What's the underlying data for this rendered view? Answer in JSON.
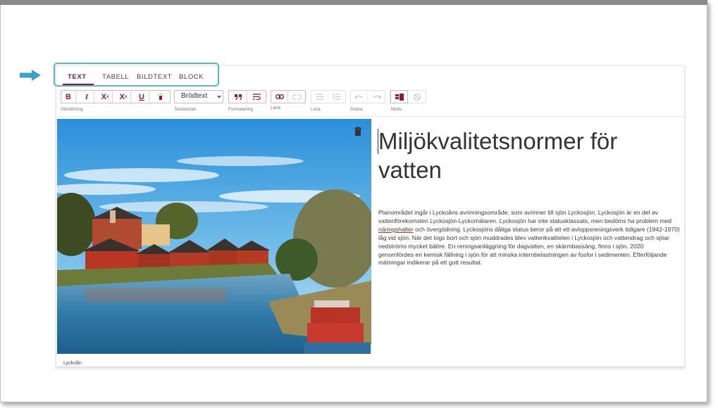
{
  "tabs": [
    {
      "label": "TEXT",
      "active": true
    },
    {
      "label": "TABELL",
      "active": false
    },
    {
      "label": "BILDTEXT",
      "active": false
    },
    {
      "label": "BLOCK",
      "active": false
    }
  ],
  "toolbar": {
    "bold": "B",
    "italic": "I",
    "superscript": "X",
    "subscript": "X",
    "underline": "U",
    "select_value": "Brödtext",
    "groups": {
      "stil": "Stilsättning",
      "textkategori": "Textatoriek",
      "formatering": "Formatering",
      "lank": "Länk",
      "lista": "Lista",
      "andra": "Ändra",
      "motiv": "Motiv"
    }
  },
  "image": {
    "caption": "Lyckoån"
  },
  "content": {
    "heading": "Miljökvalitetsnormer för vatten",
    "paragraph_before": "Planområdet ingår i Lyckoåns avrinningsområde, som avrinner till sjön Lyckosjön. Lyckosjön är en del av vattenförekomsten Lyckosjön-Lyckomälaren. Lyckosjön har inte statusklassats, men bedöms ha problem med ",
    "paragraph_underlined": "näringshalter",
    "paragraph_after": " och övergödning. Lyckosjöns dåliga status beror på att ett avloppsreningsverk tidigare (1942-1970) låg vid sjön. När det togs bort och sjön muddrades blev vattenkvaliteten i Lyckosjön och vattendrag och sjöar nedströms mycket bättre. En reningsanläggning för dagvatten, en skärmbassäng, finns i sjön. 2020 genomfördes en kemisk fällning i sjön för att minska internbelastningen av fosfor i sedimenten. Efterföljande mätningar indikerar på ett gott resultat."
  },
  "colors": {
    "accent": "#7b1e3c",
    "highlight_border": "#5fb6c6",
    "arrow": "#3ea0c8"
  }
}
